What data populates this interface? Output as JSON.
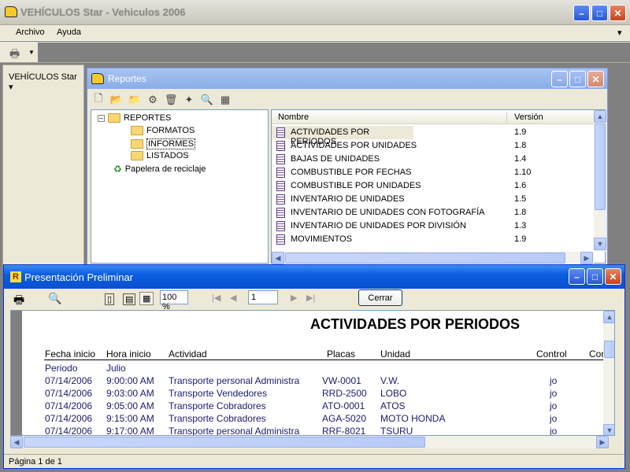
{
  "app": {
    "title": "VEHÍCULOS Star - Vehiculos 2006",
    "menu": [
      "Archivo",
      "Ayuda"
    ],
    "side_label": "VEHÍCULOS Star"
  },
  "reportes": {
    "title": "Reportes",
    "tree": {
      "root": "REPORTES",
      "children": [
        "FORMATOS",
        "INFORMES",
        "LISTADOS"
      ],
      "recycle": "Papelera de reciclaje"
    },
    "columns": [
      "Nombre",
      "Versión"
    ],
    "rows": [
      {
        "name": "ACTIVIDADES POR PERIODOS",
        "version": "1.9"
      },
      {
        "name": "ACTIVIDADES POR UNIDADES",
        "version": "1.8"
      },
      {
        "name": "BAJAS DE UNIDADES",
        "version": "1.4"
      },
      {
        "name": "COMBUSTIBLE POR FECHAS",
        "version": "1.10"
      },
      {
        "name": "COMBUSTIBLE POR UNIDADES",
        "version": "1.6"
      },
      {
        "name": "INVENTARIO DE UNIDADES",
        "version": "1.5"
      },
      {
        "name": "INVENTARIO DE UNIDADES CON FOTOGRAFÍA",
        "version": "1.8"
      },
      {
        "name": "INVENTARIO DE UNIDADES POR DIVISIÓN",
        "version": "1.3"
      },
      {
        "name": "MOVIMIENTOS",
        "version": "1.9"
      }
    ]
  },
  "preview": {
    "title": "Presentación Preliminar",
    "zoom": "100 %",
    "page": "1",
    "close_label": "Cerrar",
    "report_title": "ACTIVIDADES POR PERIODOS",
    "columns": [
      "Fecha inicio",
      "Hora inicio",
      "Actividad",
      "Placas",
      "Unidad",
      "Control",
      "Con"
    ],
    "period_label": "Periodo",
    "period_value": "Julio",
    "rows": [
      {
        "fecha": "07/14/2006",
        "hora": "9:00:00 AM",
        "actividad": "Transporte personal Administra",
        "placas": "VW-0001",
        "unidad": "V.W.",
        "control": "jo"
      },
      {
        "fecha": "07/14/2006",
        "hora": "9:03:00 AM",
        "actividad": "Transporte Vendedores",
        "placas": "RRD-2500",
        "unidad": "LOBO",
        "control": "jo"
      },
      {
        "fecha": "07/14/2006",
        "hora": "9:05:00 AM",
        "actividad": "Transporte Cobradores",
        "placas": "ATO-0001",
        "unidad": "ATOS",
        "control": "jo"
      },
      {
        "fecha": "07/14/2006",
        "hora": "9:15:00 AM",
        "actividad": "Transporte Cobradores",
        "placas": "AGA-5020",
        "unidad": "MOTO HONDA",
        "control": "jo"
      },
      {
        "fecha": "07/14/2006",
        "hora": "9:17:00 AM",
        "actividad": "Transporte personal Administra",
        "placas": "RRF-8021",
        "unidad": "TSURU",
        "control": "jo"
      }
    ],
    "status": "Página 1 de 1"
  }
}
